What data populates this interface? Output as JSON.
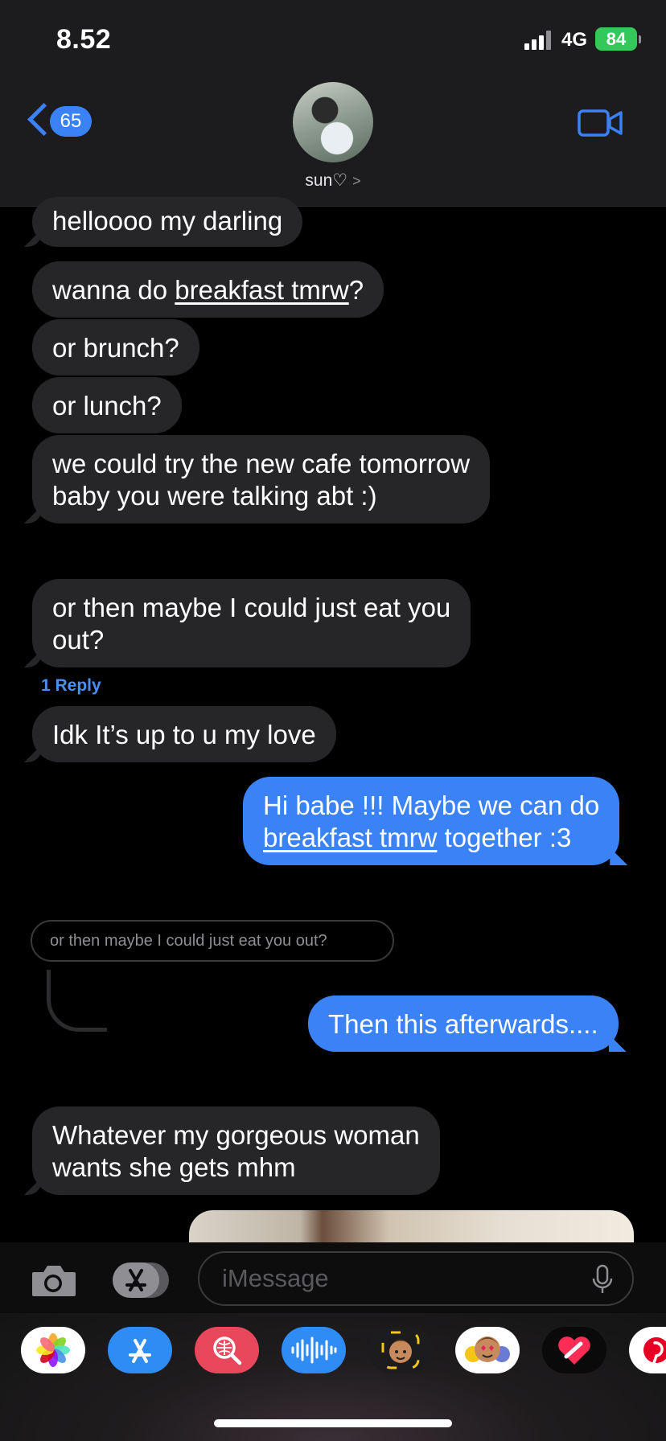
{
  "status_bar": {
    "time": "8.52",
    "network": "4G",
    "battery": "84"
  },
  "header": {
    "back_count": "65",
    "contact_name": "sun♡",
    "contact_chevron": ">"
  },
  "messages": [
    {
      "text": "helloooo my darling"
    },
    {
      "before": "wanna do ",
      "link": "breakfast tmrw",
      "after": "?"
    },
    {
      "text": "or brunch?"
    },
    {
      "text": "or lunch?"
    },
    {
      "line1": "we could try the new cafe tomorrow",
      "line2": "baby you were talking abt :)"
    },
    {
      "line1": "or then maybe I could just eat you",
      "line2": "out?"
    },
    {
      "text": "Idk It’s up to u my love"
    },
    {
      "line1": "Hi babe !!! Maybe we can do",
      "link": "breakfast tmrw",
      "after": " together :3"
    },
    {
      "text": "Then this afterwards...."
    },
    {
      "line1": "Whatever my gorgeous woman",
      "line2": "wants she gets mhm"
    }
  ],
  "reply_link": "1 Reply",
  "quoted_reply": "or then maybe I could just eat you out?",
  "input": {
    "placeholder": "iMessage"
  },
  "app_drawer": [
    "photos-icon",
    "app-store-icon",
    "search-images-icon",
    "audio-message-icon",
    "memoji-icon",
    "animoji-icon",
    "digital-touch-icon",
    "pinterest-icon"
  ]
}
